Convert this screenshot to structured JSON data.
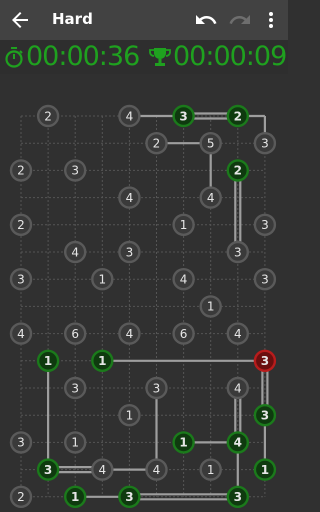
{
  "header": {
    "title": "Hard",
    "back_icon": "arrow-back-icon",
    "undo_icon": "undo-icon",
    "redo_icon": "redo-icon",
    "menu_icon": "more-vert-icon"
  },
  "timers": {
    "elapsed": "00:00:36",
    "best": "00:00:09",
    "elapsed_icon": "stopwatch-icon",
    "best_icon": "trophy-icon",
    "color": "#1fa11f"
  },
  "colors": {
    "node_default": "#5a5a5a",
    "node_complete": "#1b7a1b",
    "node_error": "#b71c1c",
    "bridge": "#9e9e9e",
    "grid": "#555555"
  },
  "board": {
    "rows": 15,
    "cols": 10,
    "islands": [
      {
        "r": 0,
        "c": 1,
        "n": "2",
        "s": "n"
      },
      {
        "r": 0,
        "c": 4,
        "n": "4",
        "s": "n"
      },
      {
        "r": 0,
        "c": 6,
        "n": "3",
        "s": "g"
      },
      {
        "r": 0,
        "c": 8,
        "n": "2",
        "s": "g"
      },
      {
        "r": 1,
        "c": 5,
        "n": "2",
        "s": "n"
      },
      {
        "r": 1,
        "c": 7,
        "n": "5",
        "s": "n"
      },
      {
        "r": 1,
        "c": 9,
        "n": "3",
        "s": "n"
      },
      {
        "r": 2,
        "c": 0,
        "n": "2",
        "s": "n"
      },
      {
        "r": 2,
        "c": 2,
        "n": "3",
        "s": "n"
      },
      {
        "r": 2,
        "c": 8,
        "n": "2",
        "s": "g"
      },
      {
        "r": 3,
        "c": 4,
        "n": "4",
        "s": "n"
      },
      {
        "r": 3,
        "c": 7,
        "n": "4",
        "s": "n"
      },
      {
        "r": 4,
        "c": 0,
        "n": "2",
        "s": "n"
      },
      {
        "r": 4,
        "c": 6,
        "n": "1",
        "s": "n"
      },
      {
        "r": 4,
        "c": 9,
        "n": "3",
        "s": "n"
      },
      {
        "r": 5,
        "c": 2,
        "n": "4",
        "s": "n"
      },
      {
        "r": 5,
        "c": 4,
        "n": "3",
        "s": "n"
      },
      {
        "r": 5,
        "c": 8,
        "n": "3",
        "s": "n"
      },
      {
        "r": 6,
        "c": 0,
        "n": "3",
        "s": "n"
      },
      {
        "r": 6,
        "c": 3,
        "n": "1",
        "s": "n"
      },
      {
        "r": 6,
        "c": 6,
        "n": "4",
        "s": "n"
      },
      {
        "r": 6,
        "c": 9,
        "n": "3",
        "s": "n"
      },
      {
        "r": 7,
        "c": 7,
        "n": "1",
        "s": "n"
      },
      {
        "r": 8,
        "c": 0,
        "n": "4",
        "s": "n"
      },
      {
        "r": 8,
        "c": 2,
        "n": "6",
        "s": "n"
      },
      {
        "r": 8,
        "c": 4,
        "n": "4",
        "s": "n"
      },
      {
        "r": 8,
        "c": 6,
        "n": "6",
        "s": "n"
      },
      {
        "r": 8,
        "c": 8,
        "n": "4",
        "s": "n"
      },
      {
        "r": 9,
        "c": 1,
        "n": "1",
        "s": "g"
      },
      {
        "r": 9,
        "c": 3,
        "n": "1",
        "s": "g"
      },
      {
        "r": 9,
        "c": 9,
        "n": "3",
        "s": "r"
      },
      {
        "r": 10,
        "c": 2,
        "n": "3",
        "s": "n"
      },
      {
        "r": 10,
        "c": 5,
        "n": "3",
        "s": "n"
      },
      {
        "r": 10,
        "c": 8,
        "n": "4",
        "s": "n"
      },
      {
        "r": 11,
        "c": 4,
        "n": "1",
        "s": "n"
      },
      {
        "r": 11,
        "c": 9,
        "n": "3",
        "s": "g"
      },
      {
        "r": 12,
        "c": 0,
        "n": "3",
        "s": "n"
      },
      {
        "r": 12,
        "c": 2,
        "n": "1",
        "s": "n"
      },
      {
        "r": 12,
        "c": 6,
        "n": "1",
        "s": "g"
      },
      {
        "r": 12,
        "c": 8,
        "n": "4",
        "s": "g"
      },
      {
        "r": 13,
        "c": 1,
        "n": "3",
        "s": "g"
      },
      {
        "r": 13,
        "c": 3,
        "n": "4",
        "s": "n"
      },
      {
        "r": 13,
        "c": 5,
        "n": "4",
        "s": "n"
      },
      {
        "r": 13,
        "c": 7,
        "n": "1",
        "s": "n"
      },
      {
        "r": 13,
        "c": 9,
        "n": "1",
        "s": "g"
      },
      {
        "r": 14,
        "c": 0,
        "n": "2",
        "s": "n"
      },
      {
        "r": 14,
        "c": 2,
        "n": "1",
        "s": "g"
      },
      {
        "r": 14,
        "c": 4,
        "n": "3",
        "s": "g"
      },
      {
        "r": 14,
        "c": 8,
        "n": "3",
        "s": "g"
      }
    ],
    "bridges": [
      {
        "a": [
          0,
          4
        ],
        "b": [
          0,
          6
        ],
        "count": 1
      },
      {
        "a": [
          0,
          6
        ],
        "b": [
          0,
          8
        ],
        "count": 2
      },
      {
        "a": [
          0,
          8
        ],
        "b": [
          0,
          9
        ],
        "count": 1
      },
      {
        "a": [
          0,
          9
        ],
        "b": [
          1,
          9
        ],
        "count": 1
      },
      {
        "a": [
          1,
          5
        ],
        "b": [
          1,
          7
        ],
        "count": 1
      },
      {
        "a": [
          1,
          7
        ],
        "b": [
          3,
          7
        ],
        "count": 1
      },
      {
        "a": [
          2,
          8
        ],
        "b": [
          5,
          8
        ],
        "count": 2
      },
      {
        "a": [
          9,
          1
        ],
        "b": [
          13,
          1
        ],
        "count": 1
      },
      {
        "a": [
          9,
          3
        ],
        "b": [
          9,
          9
        ],
        "count": 1
      },
      {
        "a": [
          9,
          9
        ],
        "b": [
          11,
          9
        ],
        "count": 2
      },
      {
        "a": [
          11,
          9
        ],
        "b": [
          13,
          9
        ],
        "count": 1
      },
      {
        "a": [
          10,
          8
        ],
        "b": [
          12,
          8
        ],
        "count": 2
      },
      {
        "a": [
          12,
          6
        ],
        "b": [
          12,
          8
        ],
        "count": 1
      },
      {
        "a": [
          12,
          8
        ],
        "b": [
          14,
          8
        ],
        "count": 1
      },
      {
        "a": [
          13,
          1
        ],
        "b": [
          13,
          3
        ],
        "count": 2
      },
      {
        "a": [
          13,
          3
        ],
        "b": [
          13,
          5
        ],
        "count": 1
      },
      {
        "a": [
          10,
          5
        ],
        "b": [
          13,
          5
        ],
        "count": 1
      },
      {
        "a": [
          14,
          2
        ],
        "b": [
          14,
          4
        ],
        "count": 1
      },
      {
        "a": [
          14,
          4
        ],
        "b": [
          14,
          8
        ],
        "count": 2
      }
    ]
  }
}
